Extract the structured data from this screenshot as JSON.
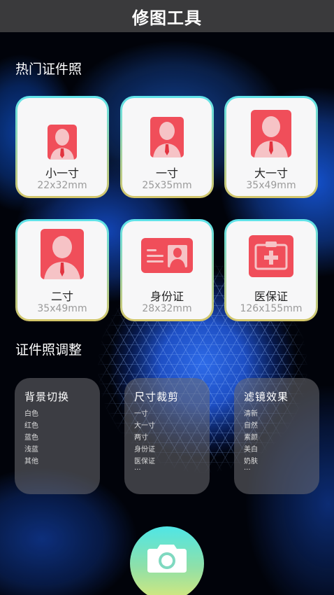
{
  "header": {
    "title": "修图工具"
  },
  "hot": {
    "title": "热门证件照",
    "items": [
      {
        "label": "小一寸",
        "size": "22x32mm",
        "icon": "portrait-icon"
      },
      {
        "label": "一寸",
        "size": "25x35mm",
        "icon": "portrait-icon"
      },
      {
        "label": "大一寸",
        "size": "35x49mm",
        "icon": "portrait-icon"
      },
      {
        "label": "二寸",
        "size": "35x49mm",
        "icon": "portrait-icon"
      },
      {
        "label": "身份证",
        "size": "28x32mm",
        "icon": "id-card-icon"
      },
      {
        "label": "医保证",
        "size": "126x155mm",
        "icon": "medical-card-icon"
      }
    ]
  },
  "adjust": {
    "title": "证件照调整",
    "panels": [
      {
        "title": "背景切换",
        "items": [
          "白色",
          "红色",
          "蓝色",
          "浅蓝",
          "其他"
        ]
      },
      {
        "title": "尺寸裁剪",
        "items": [
          "一寸",
          "大一寸",
          "两寸",
          "身份证",
          "医保证",
          "···"
        ]
      },
      {
        "title": "滤镜效果",
        "items": [
          "清新",
          "自然",
          "素颜",
          "美白",
          "奶肤",
          "···"
        ]
      }
    ]
  },
  "camera": {
    "icon": "camera-icon"
  },
  "colors": {
    "accent": "#f04e5a",
    "card_border_top": "#5fe3ea",
    "card_border_bottom": "#d4c66a",
    "topbar": "#3a3a3c"
  }
}
